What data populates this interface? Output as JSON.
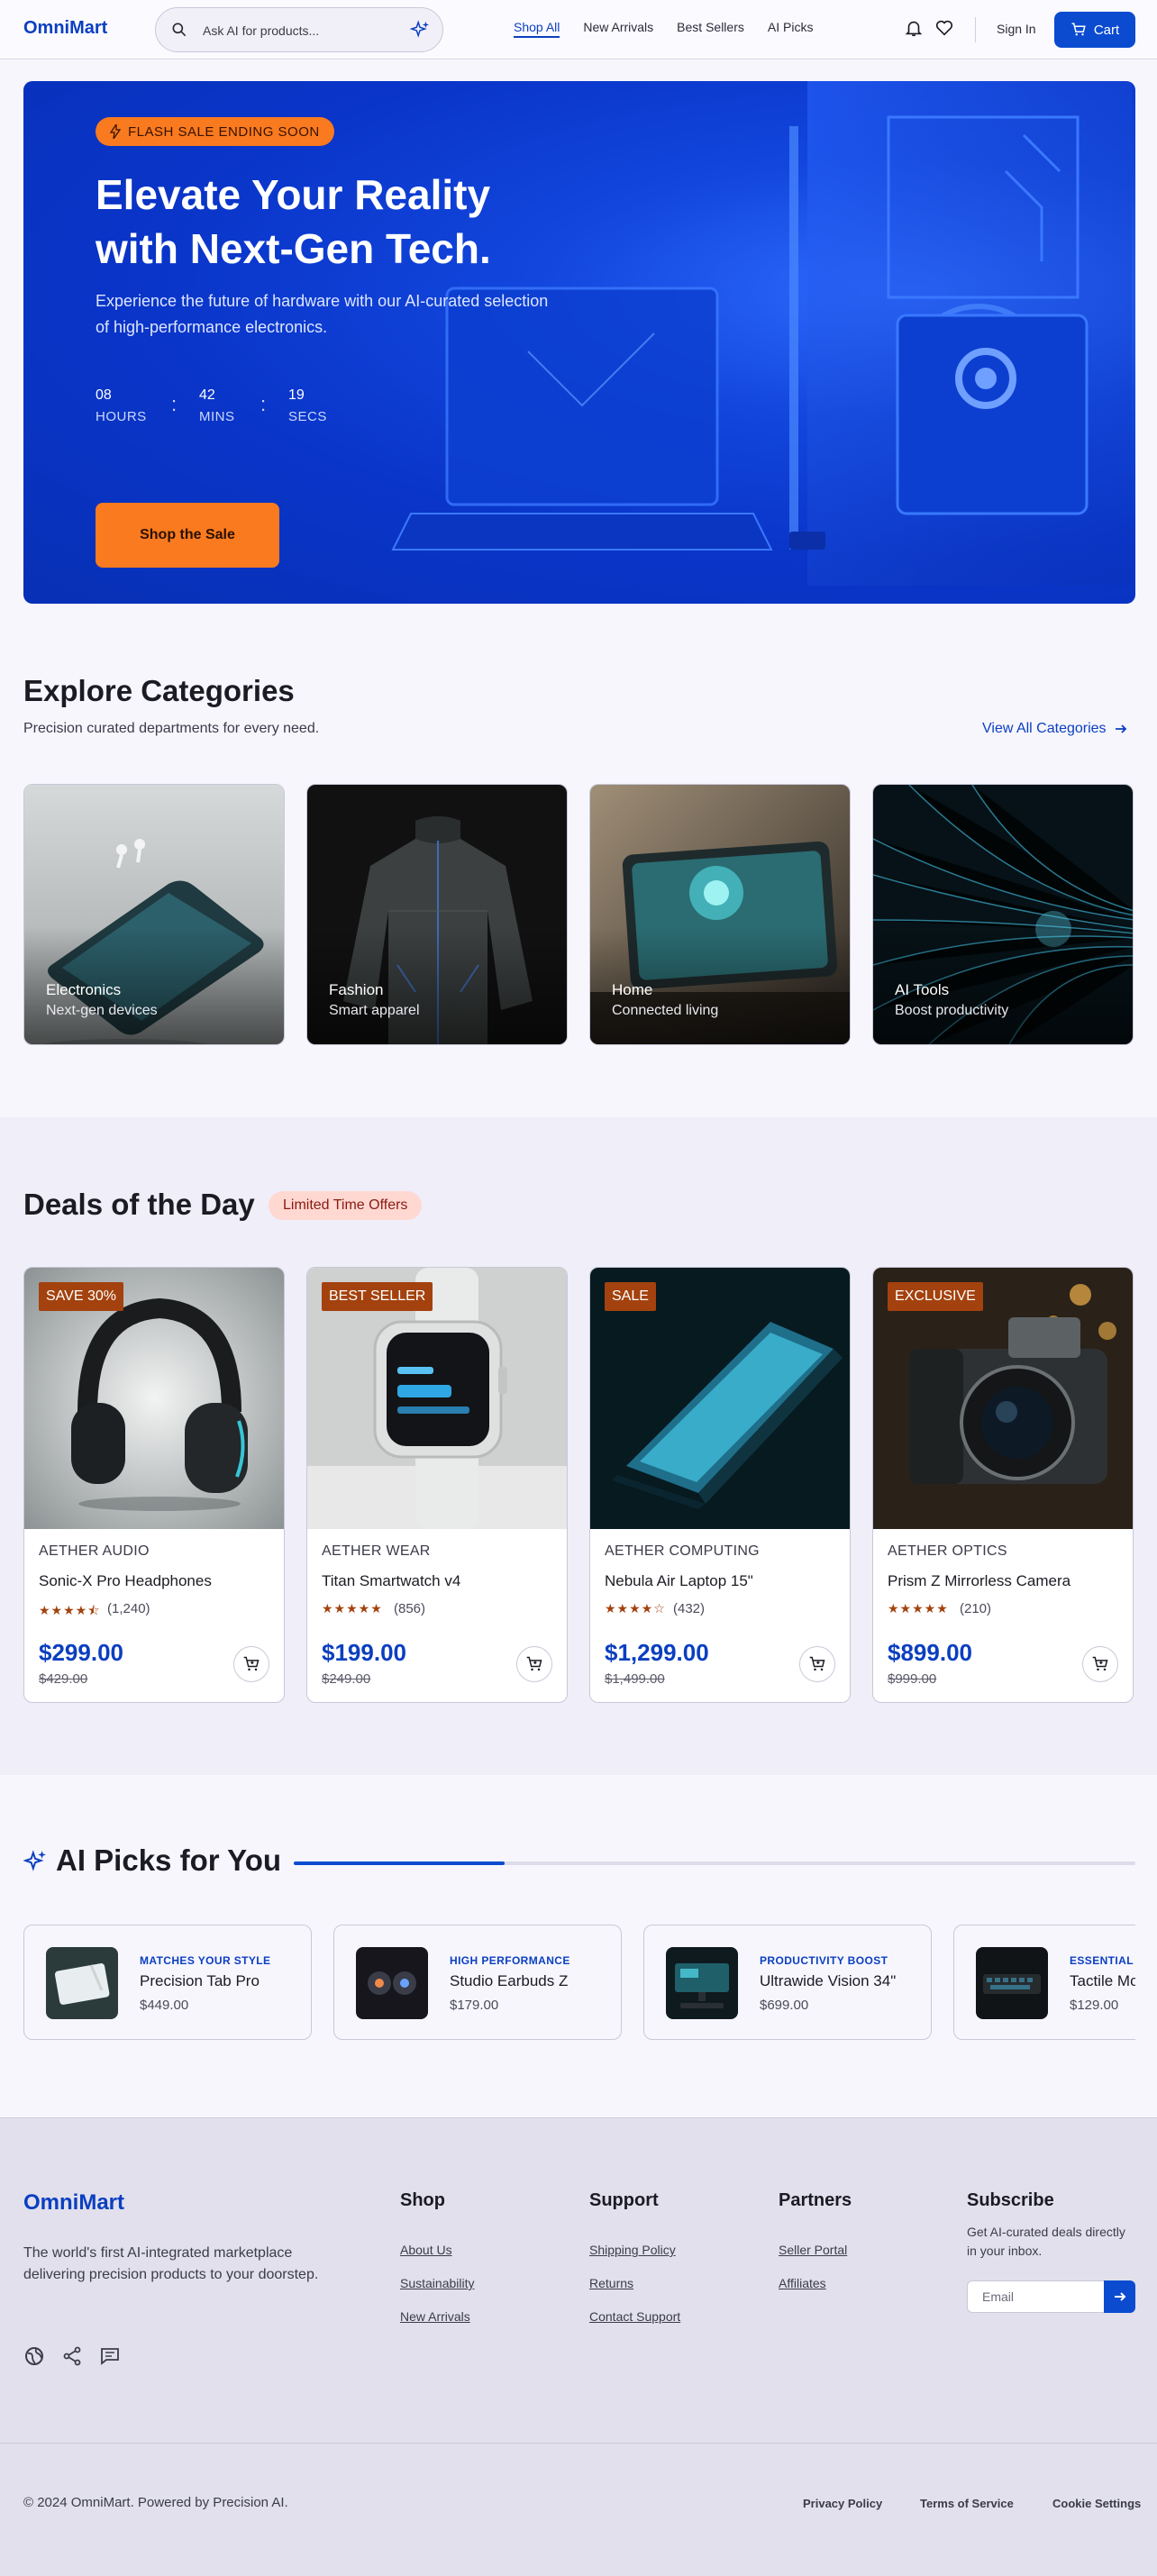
{
  "header": {
    "logo": "OmniMart",
    "search_placeholder": "Ask AI for products...",
    "nav": [
      "Shop All",
      "New Arrivals",
      "Best Sellers",
      "AI Picks"
    ],
    "sign_in": "Sign In",
    "cart": "Cart"
  },
  "hero": {
    "badge": "FLASH SALE ENDING SOON",
    "title_line1": "Elevate Your Reality",
    "title_line2": "with Next-Gen Tech.",
    "subtitle": "Experience the future of hardware with our AI-curated selection of high-performance electronics.",
    "countdown": [
      {
        "value": "08",
        "label": "HOURS"
      },
      {
        "value": "42",
        "label": "MINS"
      },
      {
        "value": "19",
        "label": "SECS"
      }
    ],
    "cta": "Shop the Sale"
  },
  "categories": {
    "title": "Explore Categories",
    "subtitle": "Precision curated departments for every need.",
    "view_all": "View All Categories",
    "items": [
      {
        "name": "Electronics",
        "desc": "Next-gen devices"
      },
      {
        "name": "Fashion",
        "desc": "Smart apparel"
      },
      {
        "name": "Home",
        "desc": "Connected living"
      },
      {
        "name": "AI Tools",
        "desc": "Boost productivity"
      }
    ]
  },
  "deals": {
    "title": "Deals of the Day",
    "tag": "Limited Time Offers",
    "items": [
      {
        "badge": "SAVE 30%",
        "brand": "AETHER AUDIO",
        "name": "Sonic-X Pro Headphones",
        "rating": 4.5,
        "reviews": "(1,240)",
        "price": "$299.00",
        "old_price": "$429.00"
      },
      {
        "badge": "BEST SELLER",
        "brand": "AETHER WEAR",
        "name": "Titan Smartwatch v4",
        "rating": 5,
        "reviews": "(856)",
        "price": "$199.00",
        "old_price": "$249.00"
      },
      {
        "badge": "SALE",
        "brand": "AETHER COMPUTING",
        "name": "Nebula Air Laptop 15\"",
        "rating": 4,
        "reviews": "(432)",
        "price": "$1,299.00",
        "old_price": "$1,499.00"
      },
      {
        "badge": "EXCLUSIVE",
        "brand": "AETHER OPTICS",
        "name": "Prism Z Mirrorless Camera",
        "rating": 5,
        "reviews": "(210)",
        "price": "$899.00",
        "old_price": "$999.00"
      }
    ]
  },
  "ai_picks": {
    "title": "AI Picks for You",
    "progress": 0.25,
    "items": [
      {
        "tag": "MATCHES YOUR STYLE",
        "name": "Precision Tab Pro",
        "price": "$449.00"
      },
      {
        "tag": "HIGH PERFORMANCE",
        "name": "Studio Earbuds Z",
        "price": "$179.00"
      },
      {
        "tag": "PRODUCTIVITY BOOST",
        "name": "Ultrawide Vision 34\"",
        "price": "$699.00"
      },
      {
        "tag": "ESSENTIAL G",
        "name": "Tactile Mo",
        "price": "$129.00"
      }
    ]
  },
  "footer": {
    "logo": "OmniMart",
    "description": "The world's first AI-integrated marketplace delivering precision products to your doorstep.",
    "columns": [
      {
        "title": "Shop",
        "links": [
          "About Us",
          "Sustainability",
          "New Arrivals"
        ]
      },
      {
        "title": "Support",
        "links": [
          "Shipping Policy",
          "Returns",
          "Contact Support"
        ]
      },
      {
        "title": "Partners",
        "links": [
          "Seller Portal",
          "Affiliates"
        ]
      }
    ],
    "subscribe": {
      "title": "Subscribe",
      "desc": "Get AI-curated deals directly in your inbox.",
      "placeholder": "Email"
    },
    "copyright": "© 2024 OmniMart. Powered by Precision AI.",
    "legal": [
      "Privacy Policy",
      "Terms of Service",
      "Cookie Settings"
    ]
  },
  "colors": {
    "primary": "#0b4bd0",
    "accent": "#f97a1f",
    "badge": "#a3420e",
    "background": "#f7f6fd"
  }
}
